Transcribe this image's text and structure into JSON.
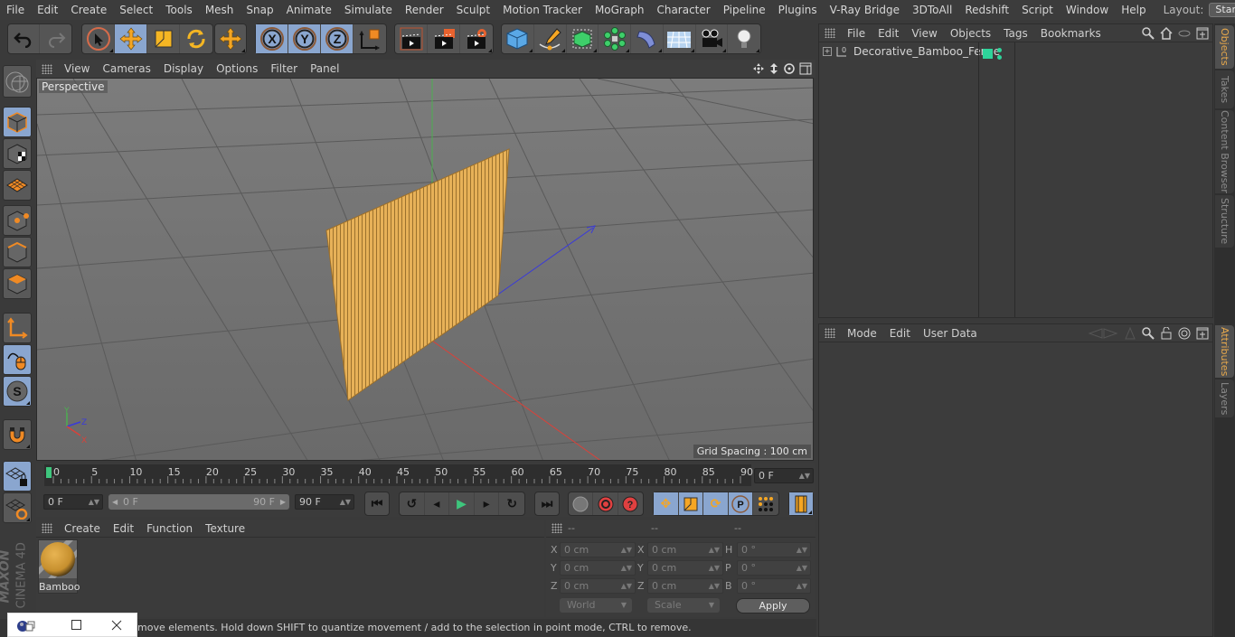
{
  "menubar": {
    "items": [
      "File",
      "Edit",
      "Create",
      "Select",
      "Tools",
      "Mesh",
      "Snap",
      "Animate",
      "Simulate",
      "Render",
      "Sculpt",
      "Motion Tracker",
      "MoGraph",
      "Character",
      "Pipeline",
      "Plugins",
      "V-Ray Bridge",
      "3DToAll",
      "Redshift",
      "Script",
      "Window",
      "Help"
    ],
    "layout_label": "Layout:",
    "layout_value": "Startup"
  },
  "toolbar": {
    "icons": [
      "undo-icon",
      "redo-icon",
      "live-selection-icon",
      "move-icon",
      "scale-icon",
      "rotate-icon",
      "recent-tool-icon",
      "x-axis-lock-icon",
      "y-axis-lock-icon",
      "z-axis-lock-icon",
      "coordinate-system-icon",
      "render-view-icon",
      "render-picture-viewer-icon",
      "render-settings-icon",
      "cube-icon",
      "pen-spline-icon",
      "subdivision-icon",
      "cloner-icon",
      "deformer-icon",
      "floor-icon",
      "camera-icon",
      "light-icon"
    ],
    "colors": {
      "active": "#8aa6cf",
      "accent": "#f5a623"
    }
  },
  "left_tools": [
    "make-editable-icon",
    "model-mode-icon",
    "texture-mode-icon",
    "workplane-icon",
    "points-mode-icon",
    "edges-mode-icon",
    "polygons-mode-icon",
    "axis-mode-icon",
    "tweak-mode-icon",
    "solo-icon",
    "snap-magnet-icon",
    "workplane-lock-icon",
    "workplane-align-icon"
  ],
  "viewport": {
    "menu": [
      "View",
      "Cameras",
      "Display",
      "Options",
      "Filter",
      "Panel"
    ],
    "camera_label": "Perspective",
    "grid_spacing": "Grid Spacing : 100 cm",
    "axis_labels": {
      "x": "X",
      "y": "Y",
      "z": "Z"
    }
  },
  "timeline": {
    "ticks": [
      "0",
      "5",
      "10",
      "15",
      "20",
      "25",
      "30",
      "35",
      "40",
      "45",
      "50",
      "55",
      "60",
      "65",
      "70",
      "75",
      "80",
      "85",
      "90"
    ],
    "current_frame_field": "0 F",
    "start_field": "0 F",
    "range_start": "0 F",
    "range_end": "90 F",
    "end_field": "90 F"
  },
  "playback": {
    "buttons": [
      "go-to-start",
      "go-to-previous-key",
      "step-back",
      "play",
      "step-forward",
      "go-to-next-key",
      "go-to-end"
    ],
    "key_buttons": [
      "record-key",
      "autokey",
      "keyframe-selection"
    ],
    "track_buttons": [
      "move-track",
      "scale-track",
      "rotate-track",
      "param-track",
      "point-level-animation",
      "timeline-window"
    ]
  },
  "material_panel": {
    "menu": [
      "Create",
      "Edit",
      "Function",
      "Texture"
    ],
    "materials": [
      {
        "name": "Bamboo"
      }
    ]
  },
  "coordinates": {
    "headers": [
      "--",
      "--",
      "--"
    ],
    "rows": [
      {
        "l1": "X",
        "v1": "0 cm",
        "l2": "X",
        "v2": "0 cm",
        "l3": "H",
        "v3": "0 °"
      },
      {
        "l1": "Y",
        "v1": "0 cm",
        "l2": "Y",
        "v2": "0 cm",
        "l3": "P",
        "v3": "0 °"
      },
      {
        "l1": "Z",
        "v1": "0 cm",
        "l2": "Z",
        "v2": "0 cm",
        "l3": "B",
        "v3": "0 °"
      }
    ],
    "mode_select": "World",
    "scale_select": "Scale",
    "apply_label": "Apply"
  },
  "status": {
    "text": "move elements. Hold down SHIFT to quantize movement / add to the selection in point mode, CTRL to remove."
  },
  "object_manager": {
    "menu": [
      "File",
      "Edit",
      "View",
      "Objects",
      "Tags",
      "Bookmarks"
    ],
    "objects": [
      {
        "name": "Decorative_Bamboo_Fence",
        "layer_color": "#2ed39a"
      }
    ]
  },
  "attributes": {
    "menu": [
      "Mode",
      "Edit",
      "User Data"
    ]
  },
  "side_tabs": {
    "top": [
      "Objects",
      "Takes",
      "Content Browser",
      "Structure"
    ],
    "bottom": [
      "Attributes",
      "Layers"
    ],
    "active_color": "#e8a94c"
  },
  "branding": {
    "logo_text_1": "MAXON",
    "logo_text_2": "CINEMA 4D"
  }
}
